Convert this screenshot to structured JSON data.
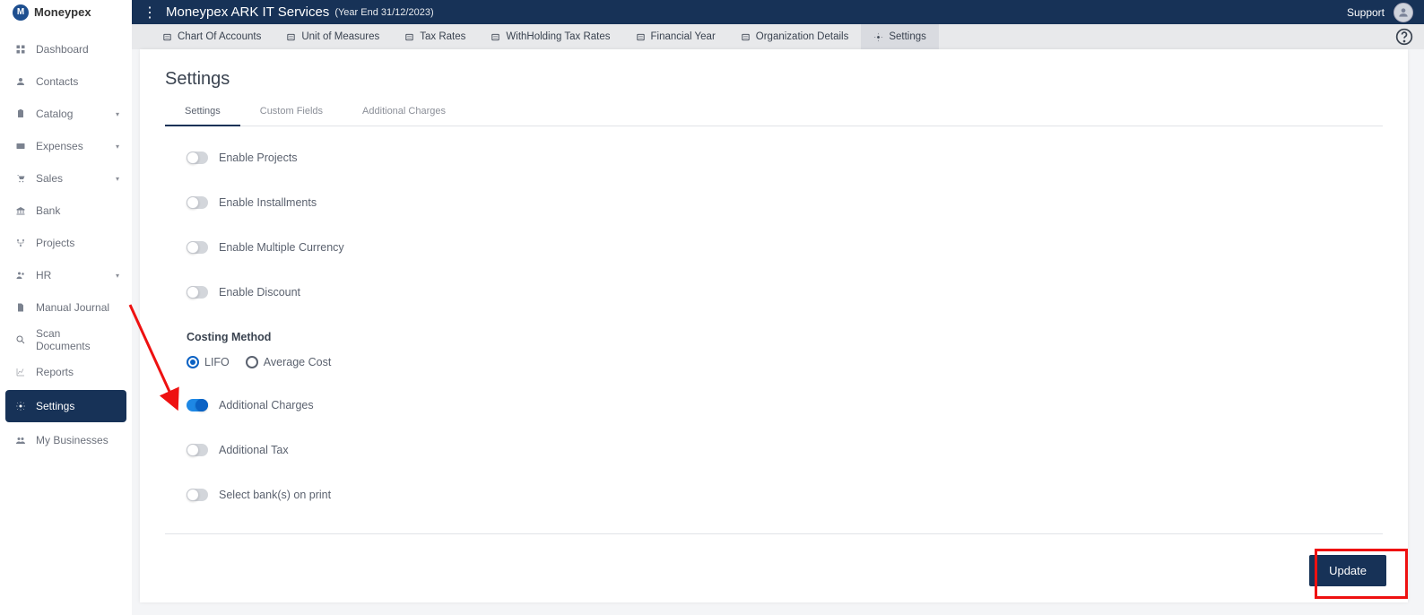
{
  "brand": "Moneypex",
  "header": {
    "company": "Moneypex ARK IT Services",
    "year_end": "(Year End 31/12/2023)",
    "support": "Support"
  },
  "sidebar": {
    "items": [
      {
        "label": "Dashboard",
        "icon": "grid-icon",
        "expand": false
      },
      {
        "label": "Contacts",
        "icon": "user-icon",
        "expand": false
      },
      {
        "label": "Catalog",
        "icon": "clipboard-icon",
        "expand": true
      },
      {
        "label": "Expenses",
        "icon": "card-icon",
        "expand": true
      },
      {
        "label": "Sales",
        "icon": "cart-icon",
        "expand": true
      },
      {
        "label": "Bank",
        "icon": "bank-icon",
        "expand": false
      },
      {
        "label": "Projects",
        "icon": "projects-icon",
        "expand": false
      },
      {
        "label": "HR",
        "icon": "people-icon",
        "expand": true
      },
      {
        "label": "Manual Journal",
        "icon": "file-icon",
        "expand": false
      },
      {
        "label": "Scan Documents",
        "icon": "search-icon",
        "expand": false
      },
      {
        "label": "Reports",
        "icon": "chart-icon",
        "expand": false
      },
      {
        "label": "Settings",
        "icon": "gear-icon",
        "expand": false,
        "active": true
      },
      {
        "label": "My Businesses",
        "icon": "group-icon",
        "expand": false
      }
    ]
  },
  "toolbar": {
    "items": [
      {
        "label": "Chart Of Accounts",
        "icon": "list-icon"
      },
      {
        "label": "Unit of Measures",
        "icon": "measure-icon"
      },
      {
        "label": "Tax Rates",
        "icon": "tax-icon"
      },
      {
        "label": "WithHolding Tax Rates",
        "icon": "withhold-icon"
      },
      {
        "label": "Financial Year",
        "icon": "calendar-icon"
      },
      {
        "label": "Organization Details",
        "icon": "org-icon"
      },
      {
        "label": "Settings",
        "icon": "gear-icon",
        "active": true
      }
    ]
  },
  "page": {
    "title": "Settings",
    "sub_tabs": [
      "Settings",
      "Custom Fields",
      "Additional Charges"
    ],
    "toggles": [
      {
        "label": "Enable Projects",
        "on": false
      },
      {
        "label": "Enable Installments",
        "on": false
      },
      {
        "label": "Enable Multiple Currency",
        "on": false
      },
      {
        "label": "Enable Discount",
        "on": false
      }
    ],
    "costing_label": "Costing Method",
    "costing_options": [
      "LIFO",
      "Average Cost"
    ],
    "costing_selected": "LIFO",
    "toggles2": [
      {
        "label": "Additional Charges",
        "on": true
      },
      {
        "label": "Additional Tax",
        "on": false
      },
      {
        "label": "Select bank(s) on print",
        "on": false
      }
    ],
    "update_label": "Update"
  }
}
